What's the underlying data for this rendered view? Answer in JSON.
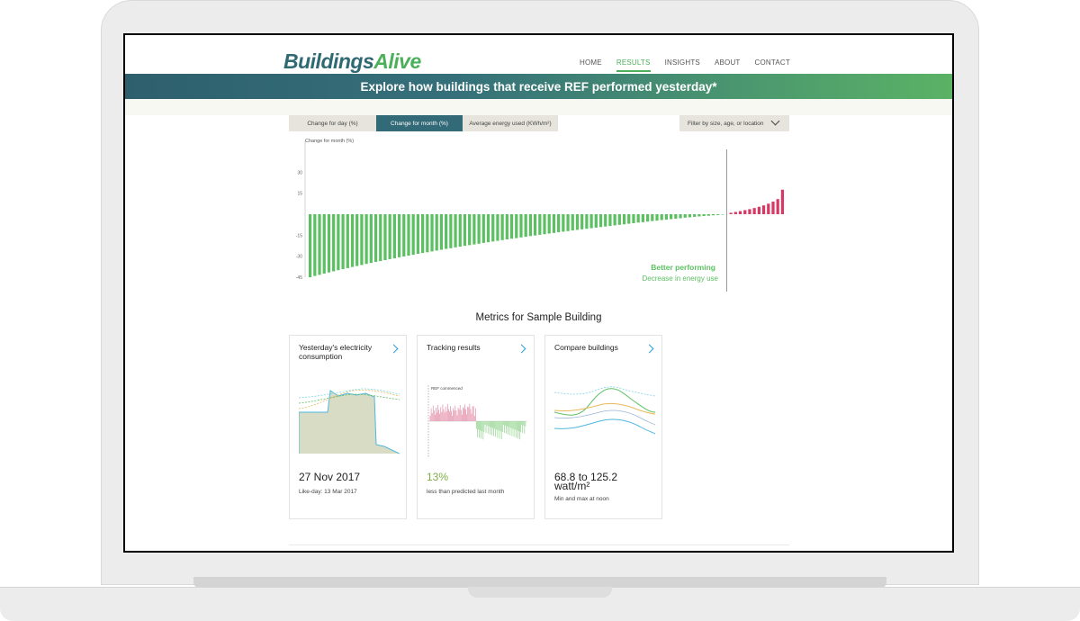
{
  "brand": {
    "logo_part1": "Buildings",
    "logo_part2": "Alive"
  },
  "nav": {
    "items": [
      {
        "label": "HOME",
        "active": false
      },
      {
        "label": "RESULTS",
        "active": true
      },
      {
        "label": "INSIGHTS",
        "active": false
      },
      {
        "label": "ABOUT",
        "active": false
      },
      {
        "label": "CONTACT",
        "active": false
      }
    ]
  },
  "banner": {
    "title": "Explore how buildings that receive REF performed yesterday*"
  },
  "tabs": [
    {
      "label": "Change for day (%)",
      "active": false
    },
    {
      "label": "Change for month (%)",
      "active": true
    },
    {
      "label": "Average energy used (KWh/m²)",
      "active": false
    }
  ],
  "filter": {
    "label": "Filter by size, age, or location",
    "icon": "chevron-down-icon"
  },
  "chart_data": {
    "type": "bar",
    "ylabel": "Change for month (%)",
    "y_ticks": [
      30,
      15,
      -15,
      -30,
      -45
    ],
    "ylim": [
      -45,
      45
    ],
    "values": [
      -45,
      -44.1,
      -43.3,
      -42.4,
      -41.6,
      -40.8,
      -40.0,
      -39.2,
      -38.5,
      -37.7,
      -37.0,
      -36.3,
      -35.5,
      -34.8,
      -34.1,
      -33.5,
      -32.8,
      -32.1,
      -31.5,
      -30.8,
      -30.2,
      -29.6,
      -29.0,
      -28.3,
      -27.7,
      -27.2,
      -26.6,
      -26.0,
      -25.4,
      -24.8,
      -24.3,
      -23.7,
      -23.2,
      -22.6,
      -22.1,
      -21.6,
      -21.1,
      -20.5,
      -20.0,
      -19.5,
      -19.0,
      -18.5,
      -18.0,
      -17.5,
      -17.1,
      -16.6,
      -16.1,
      -15.6,
      -15.2,
      -14.7,
      -14.3,
      -13.8,
      -13.4,
      -12.9,
      -12.5,
      -12.1,
      -11.6,
      -11.2,
      -10.8,
      -10.4,
      -10.0,
      -9.6,
      -9.2,
      -8.8,
      -8.4,
      -8.0,
      -7.6,
      -7.2,
      -6.8,
      -6.4,
      -6.0,
      -5.7,
      -5.3,
      -4.9,
      -4.6,
      -4.2,
      -3.9,
      -3.5,
      -3.2,
      -2.9,
      -2.5,
      -2.2,
      -1.9,
      -1.6,
      -1.3,
      -1.1,
      -0.8,
      -0.6,
      -0.3,
      1.0,
      1.6,
      2.2,
      2.9,
      3.6,
      4.4,
      5.3,
      6.3,
      7.5,
      9.0,
      10.8,
      17.5
    ],
    "annotation_title": "Better performing",
    "annotation_sub": "Decrease in energy use",
    "colors": {
      "negative": "#5cc063",
      "positive": "#d63a64",
      "divider": "#999999"
    }
  },
  "metrics": {
    "title": "Metrics for Sample Building",
    "cards": [
      {
        "title": "Yesterday's electricity consumption",
        "value": "27 Nov 2017",
        "caption": "Like-day: 13 Mar 2017",
        "icon": "chevron-right-icon"
      },
      {
        "title": "Tracking results",
        "value": "13%",
        "caption": "less than predicted last month",
        "annotation": "REF commenced",
        "icon": "chevron-right-icon"
      },
      {
        "title": "Compare buildings",
        "value_line1": "68.8 to 125.2",
        "value_line2": "watt/m²",
        "caption": "Min and max at noon",
        "icon": "chevron-right-icon"
      }
    ]
  }
}
